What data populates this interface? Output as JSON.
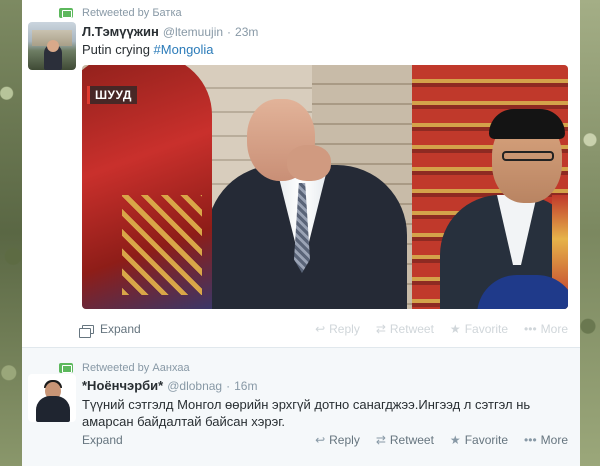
{
  "tweets": [
    {
      "retweeted_by": "Retweeted by Батка",
      "name": "Л.Тэмүүжин",
      "handle": "@ltemuujin",
      "separator": "·",
      "time": "23m",
      "text": "Putin crying ",
      "hashtag": "#Mongolia",
      "media_badge": "ШУУД",
      "actions": {
        "expand": "Expand",
        "reply": "Reply",
        "retweet": "Retweet",
        "favorite": "Favorite",
        "more": "More"
      }
    },
    {
      "retweeted_by": "Retweeted by Аанхаа",
      "name": "*Ноёнчэрби*",
      "handle": "@dlobnag",
      "separator": "·",
      "time": "16m",
      "text_line1": "Түүний сэтгэлд Монгол өөрийн эрхгүй дотно санагджээ.Ингээд л сэтгэл нь",
      "text_line2": "амарсан байдалтай байсан хэрэг.",
      "actions": {
        "expand": "Expand",
        "reply": "Reply",
        "retweet": "Retweet",
        "favorite": "Favorite",
        "more": "More"
      }
    }
  ],
  "colors": {
    "link": "#2b7bb9",
    "retweet_green": "#5cb85c",
    "secondary_text": "#8899a6"
  }
}
